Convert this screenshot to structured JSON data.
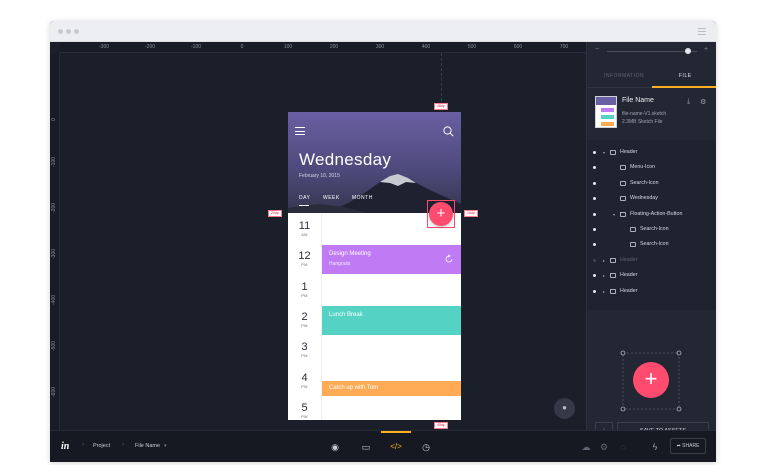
{
  "ruler": {
    "top": [
      "-300",
      "-200",
      "-100",
      "0",
      "100",
      "200",
      "300",
      "400",
      "500",
      "600",
      "700"
    ],
    "left": [
      "0",
      "-100",
      "-200",
      "-300",
      "-400",
      "-500",
      "-600",
      "-700"
    ]
  },
  "phone": {
    "title": "Wednesday",
    "date": "February 10, 2015",
    "tabs": [
      "DAY",
      "WEEK",
      "MONTH"
    ],
    "hours": [
      {
        "n": "11",
        "s": "AM"
      },
      {
        "n": "12",
        "s": "PM"
      },
      {
        "n": "1",
        "s": "PM"
      },
      {
        "n": "2",
        "s": "PM"
      },
      {
        "n": "3",
        "s": "PM"
      },
      {
        "n": "4",
        "s": "PM"
      },
      {
        "n": "5",
        "s": "PM"
      }
    ],
    "events": [
      {
        "title": "Design Meeting",
        "sub": "Hangouts",
        "color": "#c07bf4"
      },
      {
        "title": "Lunch Break",
        "sub": "",
        "color": "#54d2c4"
      },
      {
        "title": "Catch up with Tom",
        "sub": "",
        "color": "#ffaa55"
      }
    ]
  },
  "dimensions": {
    "top": "48dp",
    "left": "20dp",
    "right": "16dp",
    "bottom": "40dp"
  },
  "panel": {
    "tabs": {
      "information": "INFORMATION",
      "file": "FILE"
    },
    "file": {
      "name": "File Name",
      "filename": "file-name-V1.sketch",
      "size": "2.3MB Sketch File"
    },
    "layers": [
      {
        "label": "Header",
        "indent": 0,
        "type": "folder",
        "tri": "▾",
        "active": true
      },
      {
        "label": "Menu-Icon",
        "indent": 1,
        "type": "image",
        "tri": "",
        "active": true
      },
      {
        "label": "Search-Icon",
        "indent": 1,
        "type": "image",
        "tri": "",
        "active": true
      },
      {
        "label": "Wednesday",
        "indent": 1,
        "type": "text",
        "tri": "",
        "active": true
      },
      {
        "label": "Floating-Action-Button",
        "indent": 1,
        "type": "folder",
        "tri": "▾",
        "active": true
      },
      {
        "label": "Search-Icon",
        "indent": 2,
        "type": "image",
        "tri": "",
        "active": true
      },
      {
        "label": "Search-Icon",
        "indent": 2,
        "type": "image",
        "tri": "",
        "active": true
      },
      {
        "label": "Header",
        "indent": 0,
        "type": "folder",
        "tri": "▸",
        "active": false
      },
      {
        "label": "Header",
        "indent": 0,
        "type": "folder",
        "tri": "▸",
        "active": true
      },
      {
        "label": "Header",
        "indent": 0,
        "type": "folder",
        "tri": "▸",
        "active": true
      }
    ],
    "save_label": "SAVE TO ASSETS"
  },
  "bottombar": {
    "logo": "in",
    "project": "Project",
    "filename": "File Name",
    "share": "SHARE"
  },
  "colors": {
    "accent": "#ff4b6e",
    "tab_underline": "#ffb020"
  }
}
